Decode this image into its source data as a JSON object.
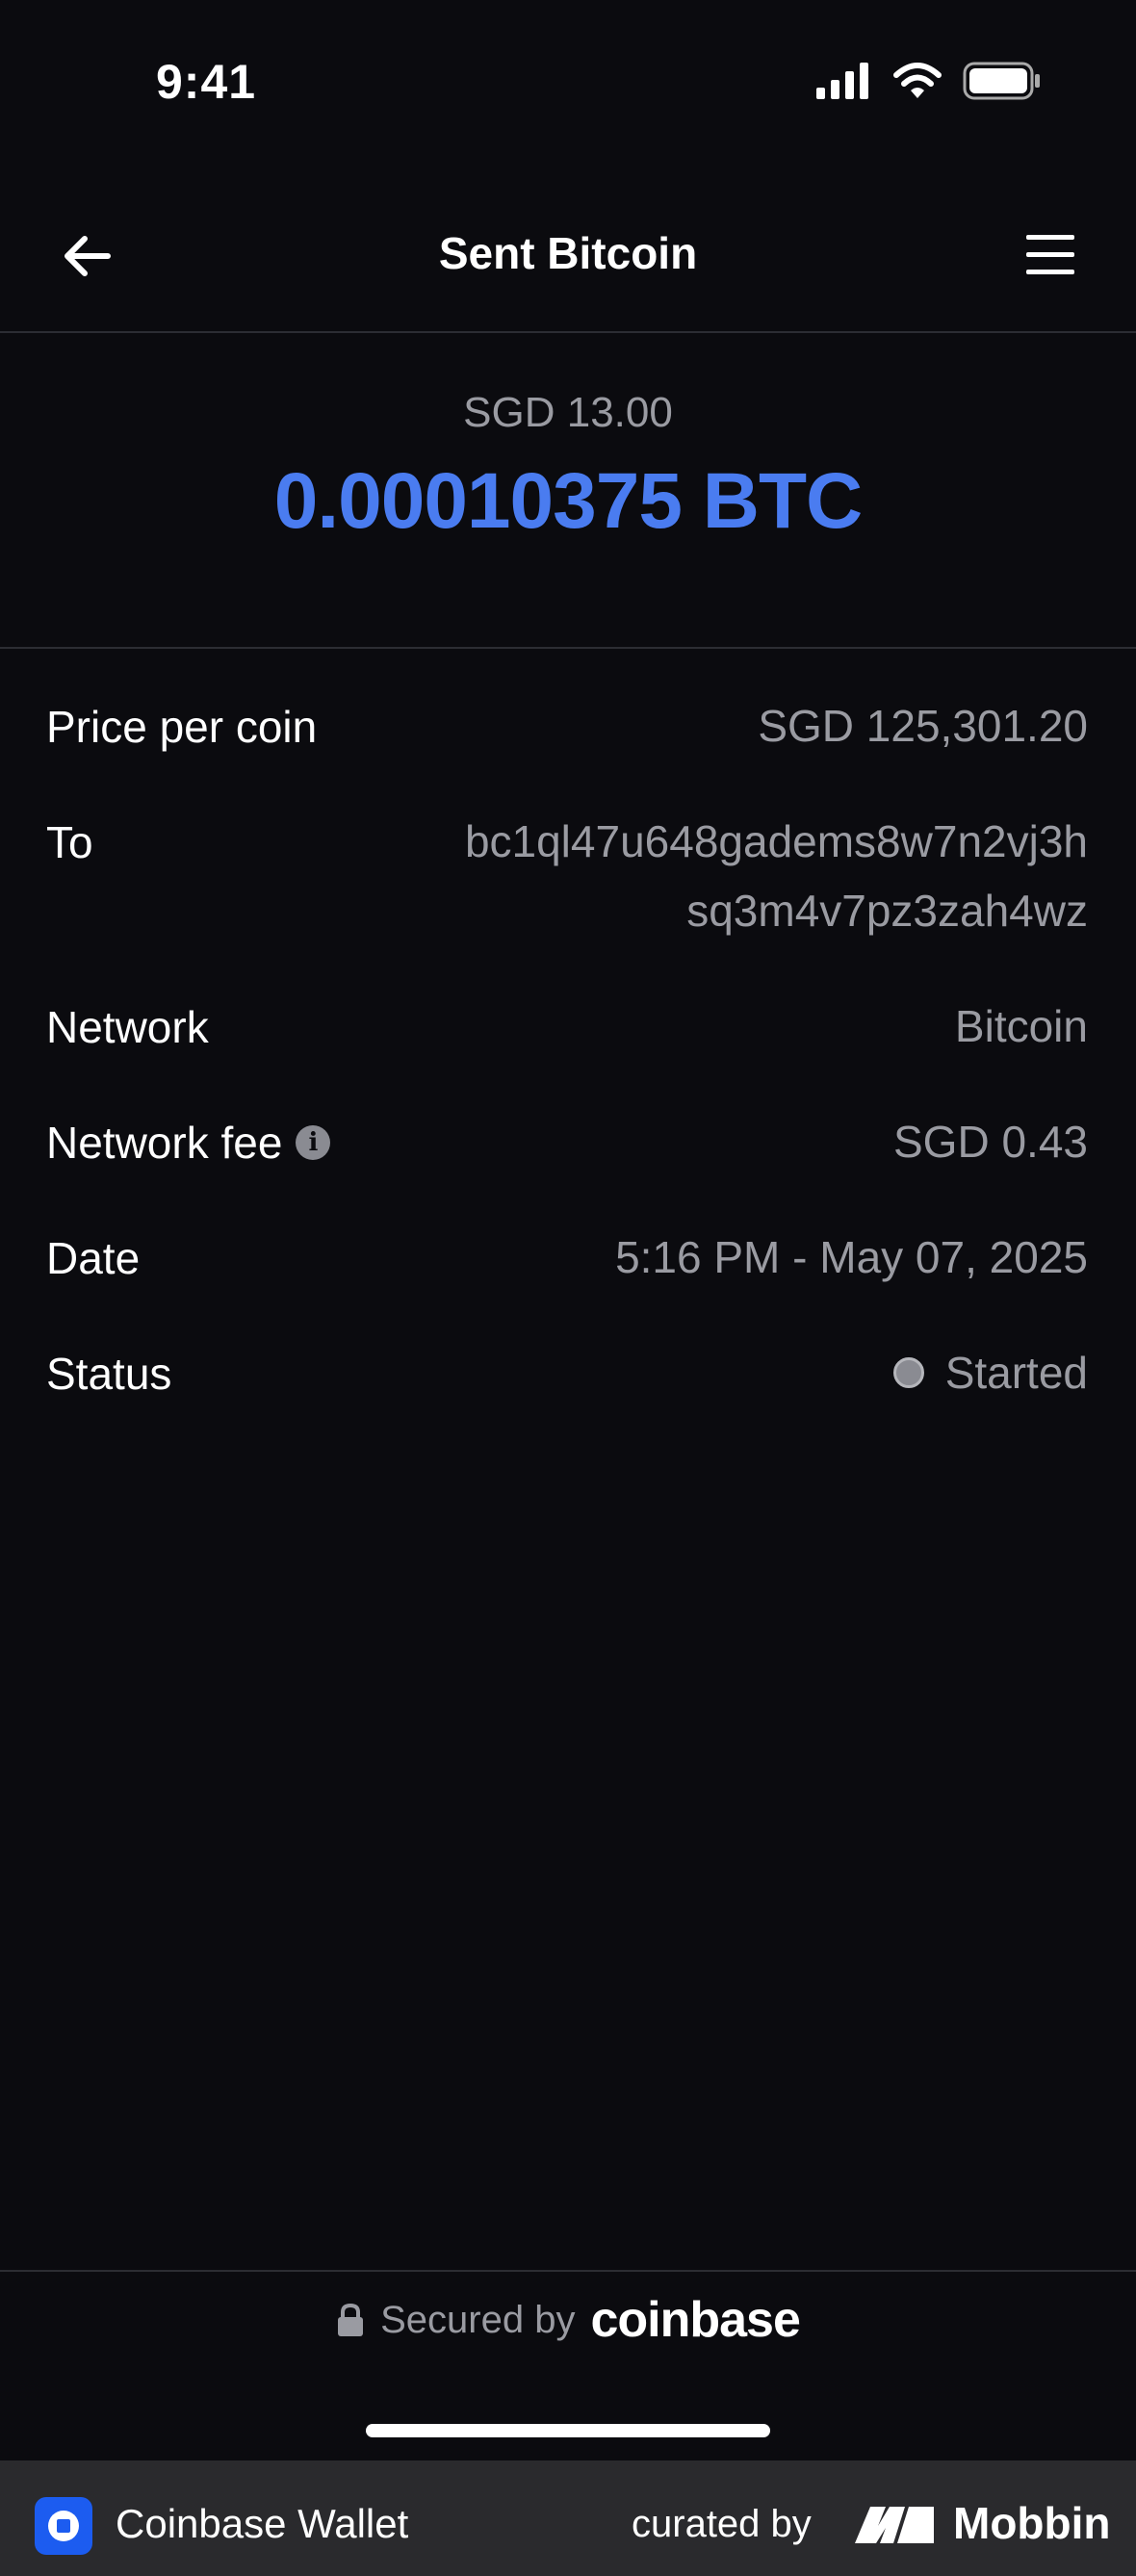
{
  "status_bar": {
    "time": "9:41"
  },
  "header": {
    "title": "Sent Bitcoin"
  },
  "amount": {
    "fiat": "SGD 13.00",
    "crypto": "0.00010375 BTC",
    "accent_color": "#4a7cf0"
  },
  "details": [
    {
      "label": "Price per coin",
      "value": "SGD 125,301.20"
    },
    {
      "label": "To",
      "value_line1": "bc1ql47u648gadems8w7n2vj3h",
      "value_line2": "sq3m4v7pz3zah4wz"
    },
    {
      "label": "Network",
      "value": "Bitcoin"
    },
    {
      "label": "Network fee",
      "value": "SGD 0.43"
    },
    {
      "label": "Date",
      "value": "5:16 PM - May 07, 2025"
    },
    {
      "label": "Status",
      "value": "Started"
    }
  ],
  "footer": {
    "secured_by": "Secured by",
    "brand": "coinbase"
  },
  "bottom_bar": {
    "app_name": "Coinbase Wallet",
    "curated_by": "curated by",
    "brand": "Mobbin"
  }
}
